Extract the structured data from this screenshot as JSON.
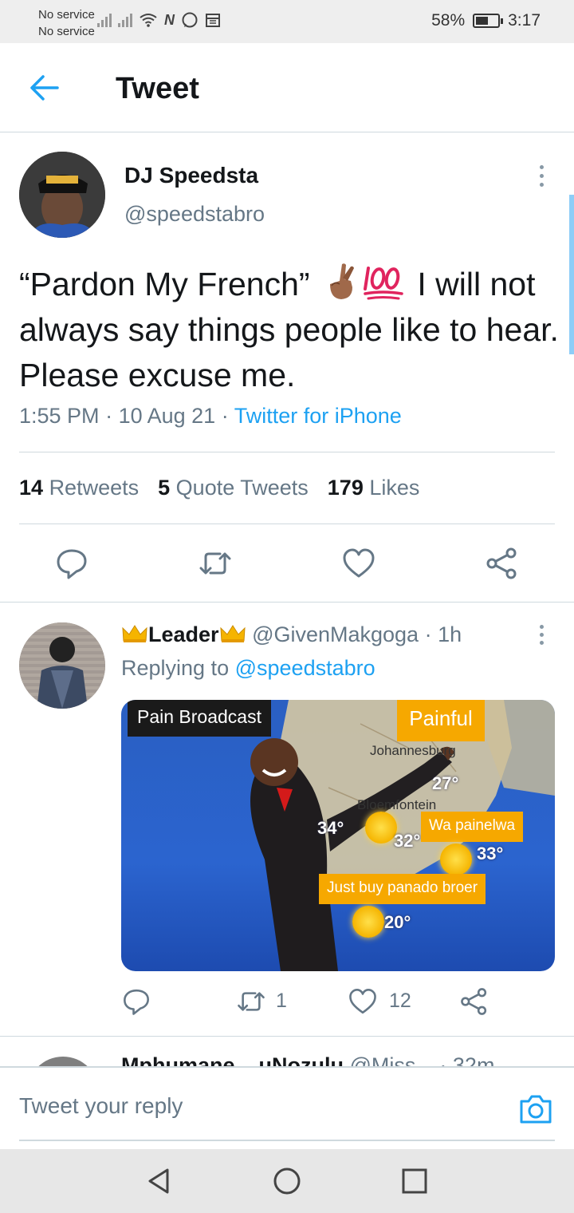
{
  "status_bar": {
    "line1": "No service",
    "line2": "No service",
    "battery": "58%",
    "battery_level": 0.58,
    "time": "3:17"
  },
  "header": {
    "title": "Tweet"
  },
  "tweet": {
    "name": "DJ Speedsta",
    "handle": "@speedstabro",
    "text_part1": "“Pardon My French”",
    "text_part2": "I will not always say things people like to hear. Please excuse me.",
    "emojis": [
      "fingers-crossed",
      "hundred-points"
    ],
    "time": "1:55 PM",
    "date": "10 Aug 21",
    "source": "Twitter for iPhone",
    "retweets_count": "14",
    "retweets_label": "Retweets",
    "quotes_count": "5",
    "quotes_label": "Quote Tweets",
    "likes_count": "179",
    "likes_label": "Likes"
  },
  "reply": {
    "name": "Leader",
    "handle": "@GivenMakgoga",
    "time": "1h",
    "replying_prefix": "Replying to",
    "replying_to": "@speedstabro",
    "retweets": "1",
    "likes": "12",
    "media": {
      "tag_top_left": "Pain Broadcast",
      "tag_top_right": "Painful",
      "tag_right": "Wa painelwa",
      "tag_bottom": "Just buy panado broer",
      "city1": "Johannesburg",
      "city2": "Bloemfontein",
      "temp1": "27°",
      "temp2": "34°",
      "temp3": "32°",
      "temp4": "33°",
      "temp5": "20°"
    }
  },
  "next_reply": {
    "name": "Mphumane _ uNozulu",
    "meta": "@Miss... · 32m"
  },
  "reply_bar": {
    "placeholder": "Tweet your reply"
  }
}
